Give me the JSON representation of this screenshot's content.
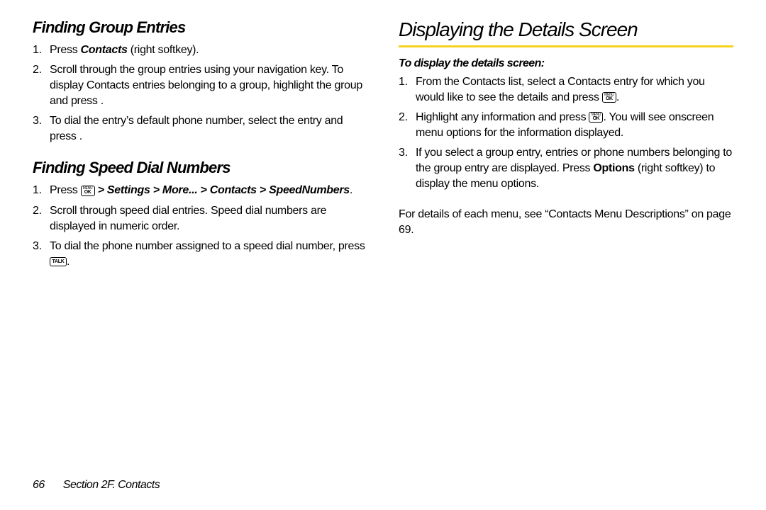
{
  "left": {
    "heading1": "Finding Group Entries",
    "list1": {
      "s1_a": "Press ",
      "s1_b": "Contacts",
      "s1_c": " (right softkey).",
      "s2": "Scroll through the group entries using your navigation key. To display Contacts entries belonging to a group, highlight the group and press         .",
      "s3": "To dial the entry’s default phone number, select the entry and press         ."
    },
    "heading2": "Finding Speed Dial Numbers",
    "list2": {
      "s1_a": "Press ",
      "s1_b": " > Settings > More... > Contacts > SpeedNumbers",
      "s1_c": ".",
      "s2": "Scroll through speed dial entries. Speed dial numbers are displayed in numeric order.",
      "s3_a": "To dial the phone number assigned to a speed dial number, press ",
      "s3_b": "."
    }
  },
  "right": {
    "title": "Displaying the Details Screen",
    "intro": "To display the details screen:",
    "list": {
      "s1_a": "From the Contacts list, select a Contacts entry for which you would like to see the details and press ",
      "s1_b": ".",
      "s2_a": "Highlight any information and press ",
      "s2_b": ". You will see onscreen menu options for the information displayed.",
      "s3_a": "If you select a group entry, entries or phone numbers belonging to the group entry are displayed. Press ",
      "s3_b": "Options",
      "s3_c": " (right softkey) to display the menu options."
    },
    "para": "For details of each menu, see “Contacts Menu Descriptions” on page 69."
  },
  "keys": {
    "menu": "MENU",
    "ok": "OK",
    "talk": "TALK"
  },
  "footer": {
    "page": "66",
    "section": "Section 2F. Contacts"
  }
}
